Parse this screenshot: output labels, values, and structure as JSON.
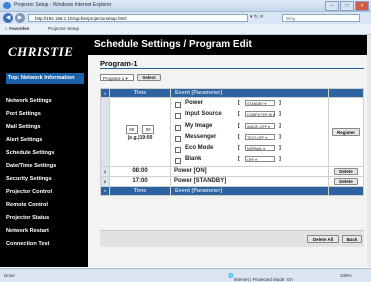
{
  "browser": {
    "title": "Projector Setup - Windows Internet Explorer",
    "address": "http://192.168.1.10/cgi-bin/projectorsetup.html",
    "search_placeholder": "Bing",
    "favorites_label": "Favorites",
    "fav_tab": "Projector Setup",
    "status_left": "Done",
    "status_zone": "Internet | Protected Mode: On",
    "zoom": "100%"
  },
  "sidebar": {
    "logo": "CHRISTIE",
    "top_link": "Top: Network Information",
    "items": [
      "Network Settings",
      "Port Settings",
      "Mail Settings",
      "Alert Settings",
      "Schedule Settings",
      "Date/Time Settings",
      "Security Settings",
      "Projector Control",
      "Remote Control",
      "Projector Status",
      "Network Restart",
      "Connection Test"
    ]
  },
  "main": {
    "header": "Schedule Settings / Program Edit",
    "program_title": "Program-1",
    "program_select": "Program-1",
    "select_button": "Select",
    "col_time": "Time",
    "col_event": "Event [Parameter]",
    "hour_value": "00",
    "minute_value": "00",
    "time_hint": "(e.g.)19:00",
    "events": [
      {
        "name": "Power",
        "param": "STANDBY"
      },
      {
        "name": "Input Source",
        "param": "COMPUTER IN"
      },
      {
        "name": "My Image",
        "param": "IMAGE-OFF"
      },
      {
        "name": "Messenger",
        "param": "TEXT-OFF"
      },
      {
        "name": "Eco Mode",
        "param": "NORMAL"
      },
      {
        "name": "Blank",
        "param": "OFF"
      }
    ],
    "register_button": "Register",
    "rows": [
      {
        "index": "1",
        "time": "08:00",
        "event": "Power [ON]",
        "action": "Delete"
      },
      {
        "index": "2",
        "time": "17:00",
        "event": "Power [STANDBY]",
        "action": "Delete"
      }
    ],
    "delete_all_button": "Delete All",
    "back_button": "Back"
  }
}
